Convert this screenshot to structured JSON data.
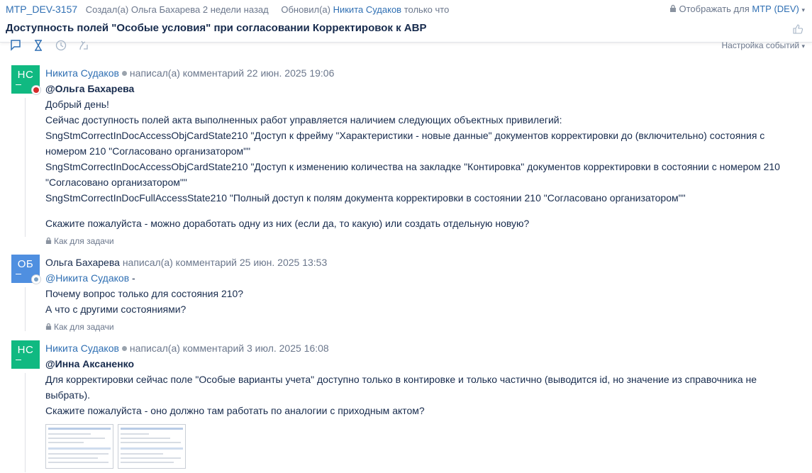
{
  "header": {
    "issue_key": "MTP_DEV-3157",
    "created": "Создал(а) Ольга Бахарева 2 недели назад",
    "updated_prefix": "Обновил(а)",
    "updated_by": "Никита Судаков",
    "updated_when": "только что",
    "visibility_prefix": "Отображать для",
    "visibility_value": "МТР (DEV)",
    "title": "Доступность полей \"Особые условия\" при согласовании Корректировок к АВР"
  },
  "toolbar": {
    "tabs": [
      "comments",
      "history",
      "time",
      "transitions"
    ],
    "events_setting": "Настройка событий"
  },
  "comments": [
    {
      "initials": "НС",
      "author": "Никита Судаков",
      "action": "написал(а) комментарий",
      "date": "22 июн. 2025 19:06",
      "mention": "@Ольга Бахарева",
      "lines": [
        "Добрый день!",
        "Сейчас доступность полей акта выполненных работ управляется наличием следующих объектных привилегий:",
        "SngStmCorrectInDocAccessObjCardState210 \"Доступ к фрейму \"Характеристики - новые данные\" документов корректировки до (включительно) состояния с номером 210 \"Согласовано организатором\"\"",
        "SngStmCorrectInDocAccessObjCardState210 \"Доступ к изменению количества на закладке \"Контировка\" документов корректировки в состоянии с номером 210 \"Согласовано организатором\"\"",
        "SngStmCorrectInDocFullAccessState210 \"Полный доступ к полям документа корректировки в состоянии 210 \"Согласовано организатором\"\""
      ],
      "question": "Скажите пожалуйста - можно доработать одну из них (если да, то какую) или создать отдельную новую?",
      "permission": "Как для задачи"
    },
    {
      "initials": "ОБ",
      "author": "Ольга Бахарева",
      "action": "написал(а) комментарий",
      "date": "25 июн. 2025 13:53",
      "mention": "@Никита Судаков",
      "mention_suffix": " -",
      "lines": [
        "Почему вопрос только для состояния 210?",
        "А что с другими состояниями?"
      ],
      "permission": "Как для задачи"
    },
    {
      "initials": "НС",
      "author": "Никита Судаков",
      "action": "написал(а) комментарий",
      "date": "3 июл. 2025 16:08",
      "mention": "@Инна Аксаненко",
      "lines": [
        "Для корректировки сейчас поле \"Особые варианты учета\" доступно только в контировке и только частично (выводится id, но значение из справочника не выбрать).",
        "Скажите пожалуйста - оно должно там работать по аналогии с приходным актом?"
      ]
    }
  ],
  "colors": {
    "link": "#2f6fb3",
    "avatar_green": "#10b981",
    "avatar_blue": "#4f8fe0",
    "muted": "#6b778c"
  }
}
